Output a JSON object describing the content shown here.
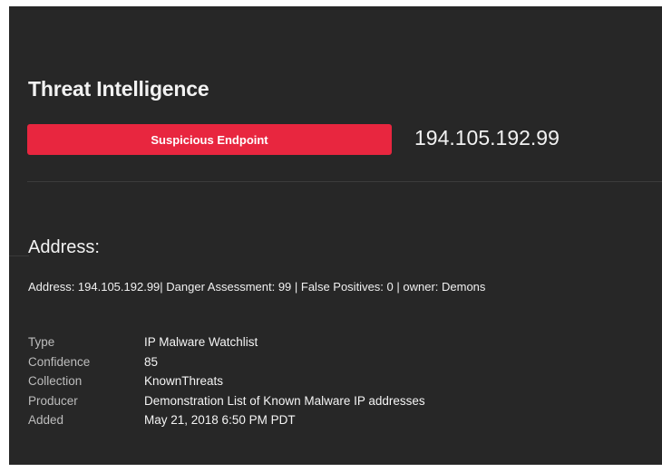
{
  "threat_panel": {
    "title": "Threat Intelligence",
    "badge_label": "Suspicious Endpoint",
    "badge_color": "#e8263f",
    "ip_address": "194.105.192.99",
    "section_heading": "Address:",
    "summary": "Address: 194.105.192.99| Danger Assessment: 99 | False Positives: 0 | owner: Demons",
    "details": [
      {
        "label": "Type",
        "value": "IP Malware Watchlist"
      },
      {
        "label": "Confidence",
        "value": "85"
      },
      {
        "label": "Collection",
        "value": "KnownThreats"
      },
      {
        "label": "Producer",
        "value": "Demonstration List of Known Malware IP addresses"
      },
      {
        "label": "Added",
        "value": "May 21, 2018 6:50 PM PDT"
      }
    ]
  }
}
